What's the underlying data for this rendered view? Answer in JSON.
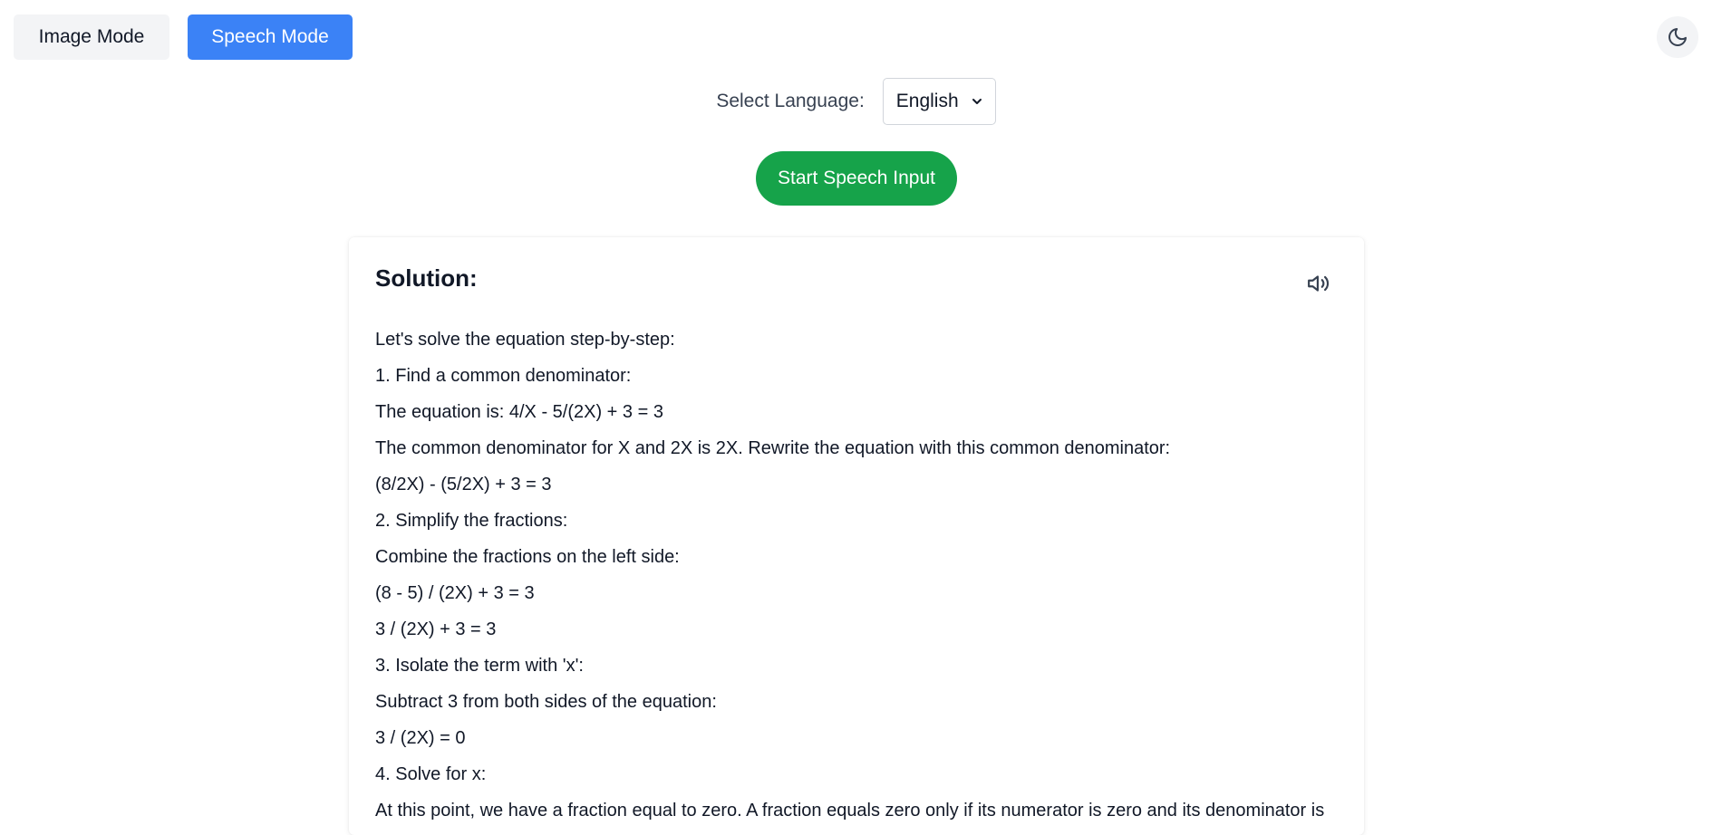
{
  "modes": {
    "image_label": "Image Mode",
    "speech_label": "Speech Mode",
    "active": "Speech Mode"
  },
  "theme_toggle": {
    "icon": "moon-icon"
  },
  "language": {
    "label": "Select Language:",
    "selected": "English"
  },
  "speech_button": {
    "label": "Start Speech Input"
  },
  "solution": {
    "title": "Solution:",
    "speaker_icon": "speaker-icon",
    "lines": [
      "Let's solve the equation step-by-step:",
      "1. Find a common denominator:",
      "The equation is: 4/X - 5/(2X) + 3 = 3",
      "The common denominator for X and 2X is 2X. Rewrite the equation with this common denominator:",
      "(8/2X) - (5/2X) + 3 = 3",
      "2. Simplify the fractions:",
      "Combine the fractions on the left side:",
      "(8 - 5) / (2X) + 3 = 3",
      "3 / (2X) + 3 = 3",
      "3. Isolate the term with 'x':",
      "Subtract 3 from both sides of the equation:",
      "3 / (2X) = 0",
      "4. Solve for x:",
      "At this point, we have a fraction equal to zero. A fraction equals zero only if its numerator is zero and its denominator is"
    ]
  },
  "colors": {
    "primary_blue": "#3b82f6",
    "start_green": "#16a34a",
    "muted_bg": "#f3f4f6"
  }
}
